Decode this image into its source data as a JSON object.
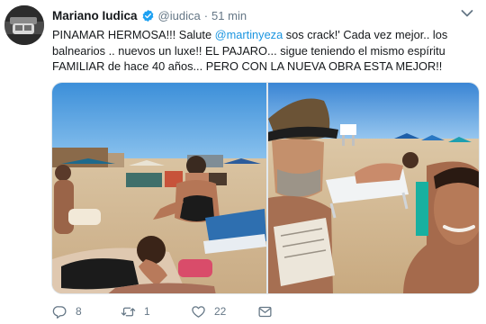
{
  "tweet": {
    "author": {
      "display_name": "Mariano Iudica",
      "handle": "@iudica",
      "verified": true
    },
    "separator": "·",
    "time": "51 min",
    "text": {
      "part1": "PINAMAR HERMOSA!!! Salute ",
      "mention": "@martinyeza",
      "part2": " sos crack!' Cada vez mejor.. los balnearios .. nuevos un luxe!! EL PAJARO... sigue teniendo el mismo espíritu FAMILIAR de  hace 40 años... PERO CON LA NUEVA OBRA ESTA MEJOR!!"
    },
    "actions": {
      "replies": "8",
      "retweets": "1",
      "likes": "22"
    }
  },
  "icons": {
    "verified": "verified-badge-icon",
    "menu": "chevron-down-icon",
    "reply": "reply-icon",
    "retweet": "retweet-icon",
    "like": "heart-icon",
    "message": "direct-message-icon"
  },
  "colors": {
    "accent": "#1b95e0",
    "text": "#14171a",
    "muted": "#657786",
    "border": "#e1e8ed"
  }
}
